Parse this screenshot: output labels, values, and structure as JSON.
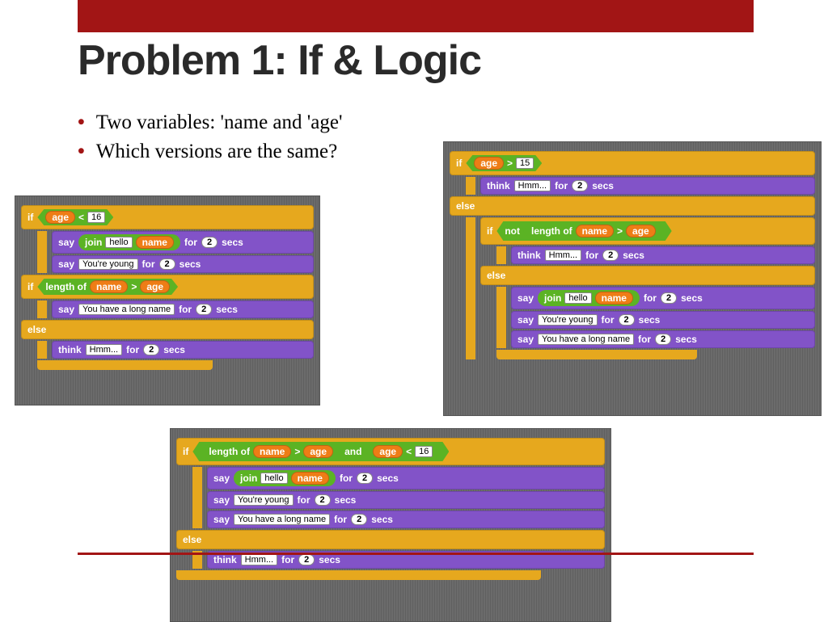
{
  "title": "Problem 1: If & Logic",
  "bullets": [
    "Two variables: 'name and 'age'",
    "Which versions are the same?"
  ],
  "kw": {
    "if": "if",
    "else": "else",
    "say": "say",
    "think": "think",
    "for": "for",
    "secs": "secs",
    "join": "join",
    "lengthof": "length of",
    "not": "not",
    "and": "and"
  },
  "vals": {
    "age": "age",
    "name": "name",
    "hello": "hello",
    "young": "You're young",
    "longname": "You have a long name",
    "hmm": "Hmm...",
    "two": "2",
    "n16": "16",
    "n15": "15",
    "gt": ">",
    "lt": "<"
  }
}
